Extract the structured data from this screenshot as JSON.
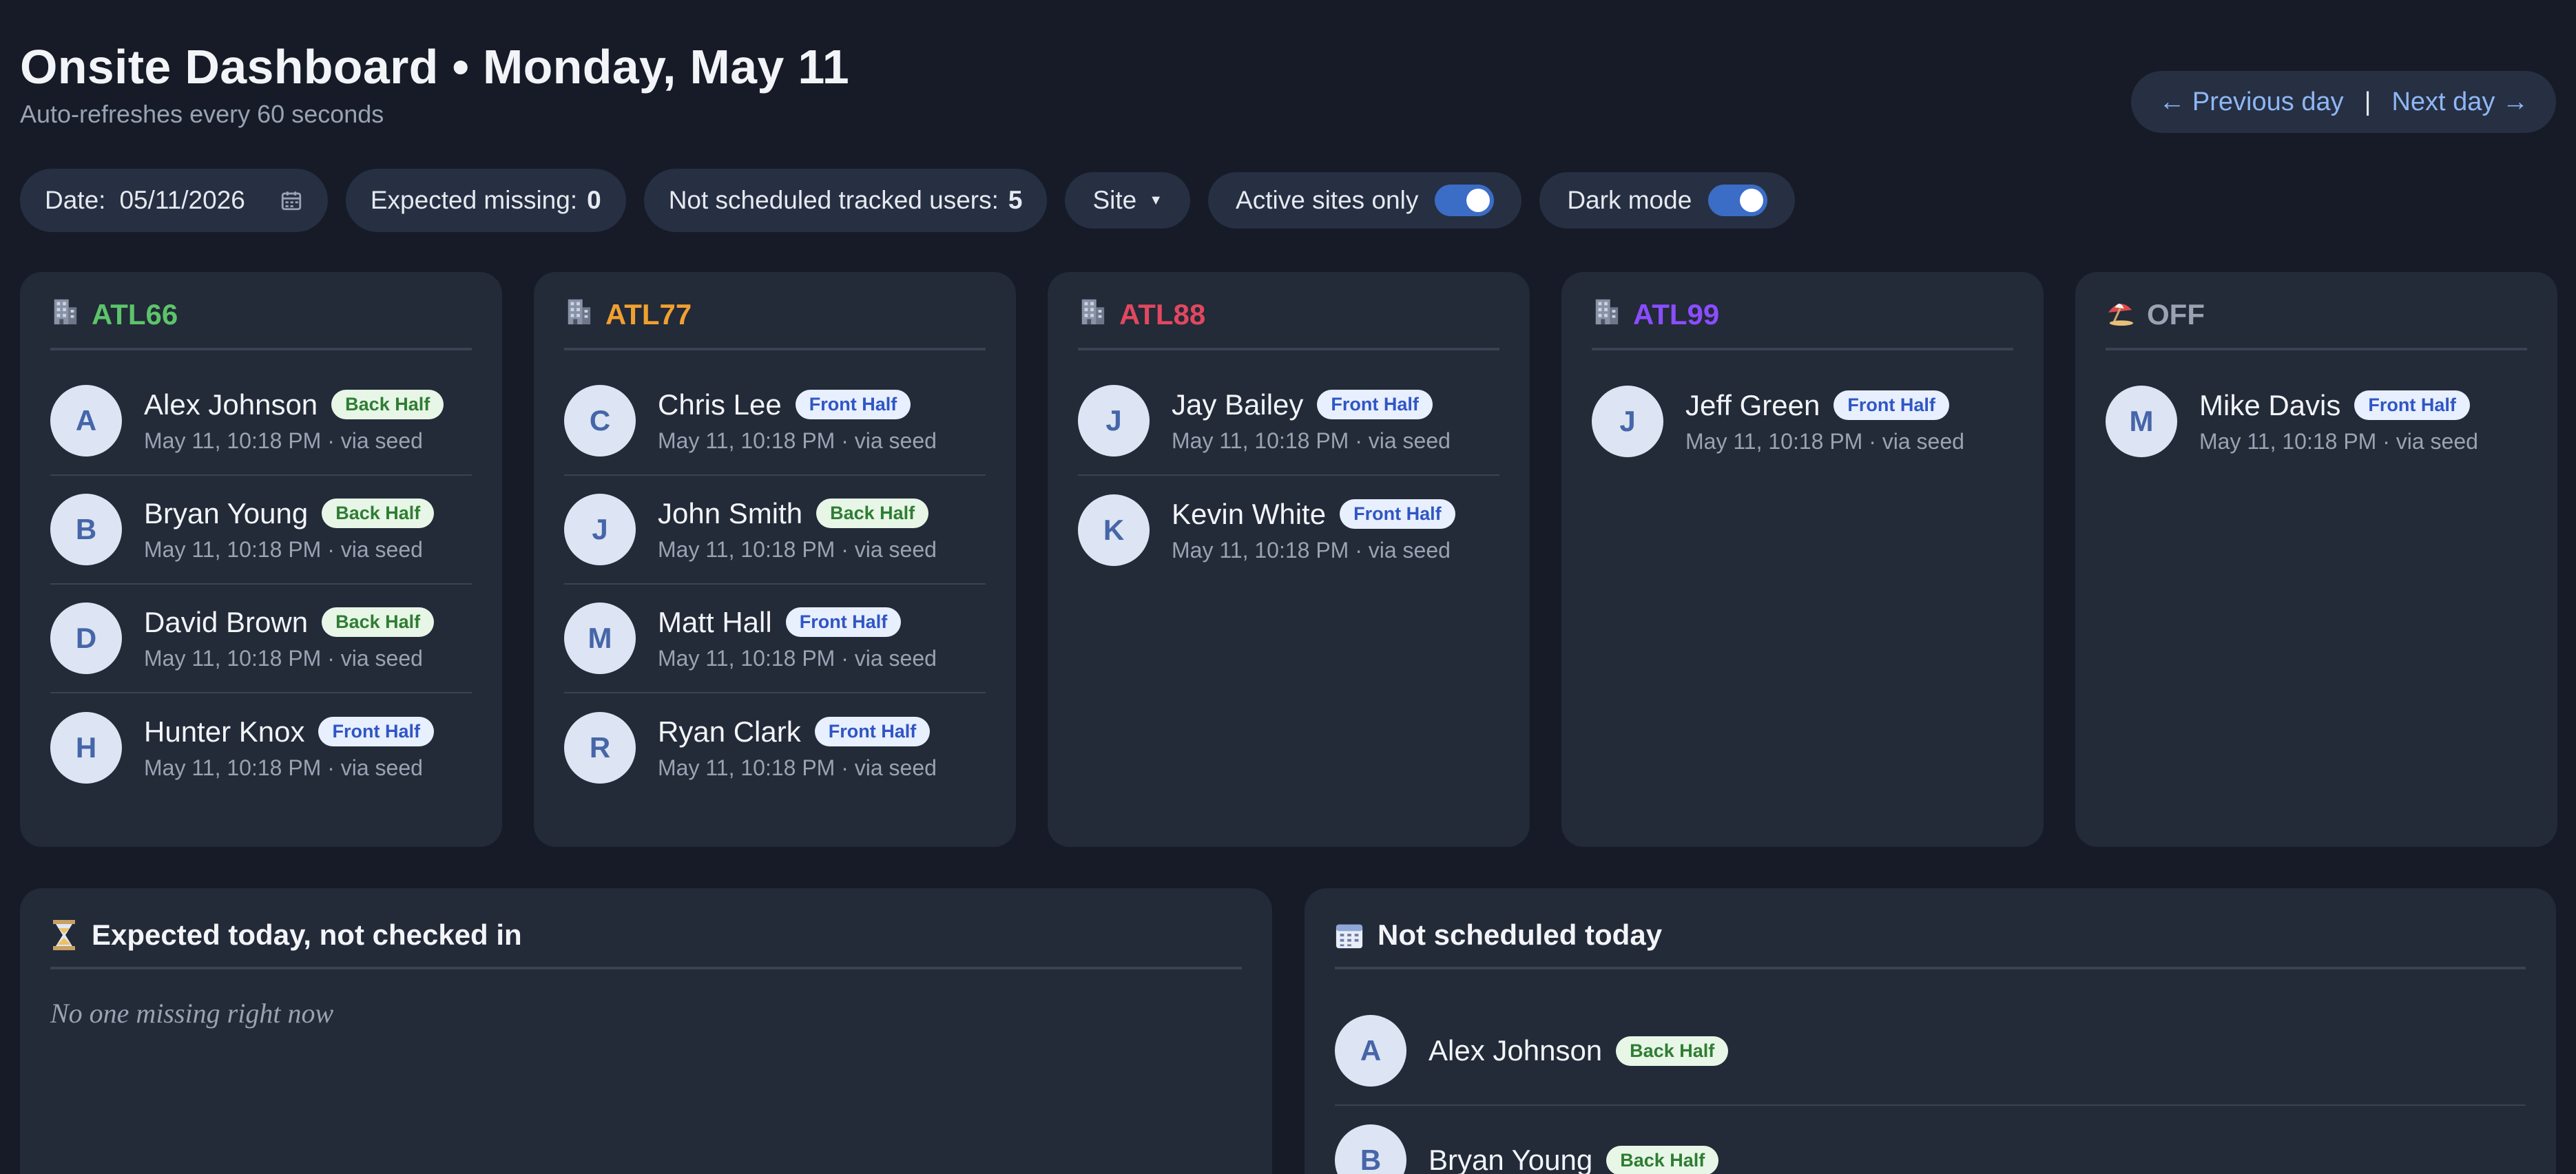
{
  "header": {
    "title": "Onsite Dashboard • Monday, May 11",
    "subtitle": "Auto-refreshes every 60 seconds",
    "prev_label": "← Previous day",
    "sep": "|",
    "next_label": "Next day →"
  },
  "toolbar": {
    "date_label": "Date:",
    "date_value": "05/11/2026",
    "expected_missing_label": "Expected missing:",
    "expected_missing_value": "0",
    "not_scheduled_label": "Not scheduled tracked users:",
    "not_scheduled_value": "5",
    "site_select": "Site",
    "active_sites_label": "Active sites only",
    "dark_mode_label": "Dark mode"
  },
  "colors": {
    "ATL66": "#5cc46a",
    "ATL77": "#f0a030",
    "ATL88": "#e0485e",
    "ATL99": "#8a4dff",
    "OFF": "#9aa3b3"
  },
  "sites": [
    {
      "name": "ATL66",
      "icon": "building-icon",
      "people": [
        {
          "initial": "A",
          "name": "Alex Johnson",
          "badge": "Back Half",
          "meta": "May 11, 10:18 PM · via seed"
        },
        {
          "initial": "B",
          "name": "Bryan Young",
          "badge": "Back Half",
          "meta": "May 11, 10:18 PM · via seed"
        },
        {
          "initial": "D",
          "name": "David Brown",
          "badge": "Back Half",
          "meta": "May 11, 10:18 PM · via seed"
        },
        {
          "initial": "H",
          "name": "Hunter Knox",
          "badge": "Front Half",
          "meta": "May 11, 10:18 PM · via seed"
        }
      ]
    },
    {
      "name": "ATL77",
      "icon": "building-icon",
      "people": [
        {
          "initial": "C",
          "name": "Chris Lee",
          "badge": "Front Half",
          "meta": "May 11, 10:18 PM · via seed"
        },
        {
          "initial": "J",
          "name": "John Smith",
          "badge": "Back Half",
          "meta": "May 11, 10:18 PM · via seed"
        },
        {
          "initial": "M",
          "name": "Matt Hall",
          "badge": "Front Half",
          "meta": "May 11, 10:18 PM · via seed"
        },
        {
          "initial": "R",
          "name": "Ryan Clark",
          "badge": "Front Half",
          "meta": "May 11, 10:18 PM · via seed"
        }
      ]
    },
    {
      "name": "ATL88",
      "icon": "building-icon",
      "people": [
        {
          "initial": "J",
          "name": "Jay Bailey",
          "badge": "Front Half",
          "meta": "May 11, 10:18 PM · via seed"
        },
        {
          "initial": "K",
          "name": "Kevin White",
          "badge": "Front Half",
          "meta": "May 11, 10:18 PM · via seed"
        }
      ]
    },
    {
      "name": "ATL99",
      "icon": "building-icon",
      "people": [
        {
          "initial": "J",
          "name": "Jeff Green",
          "badge": "Front Half",
          "meta": "May 11, 10:18 PM · via seed"
        }
      ]
    },
    {
      "name": "OFF",
      "icon": "beach-umbrella-icon",
      "people": [
        {
          "initial": "M",
          "name": "Mike Davis",
          "badge": "Front Half",
          "meta": "May 11, 10:18 PM · via seed"
        }
      ]
    }
  ],
  "missing_panel": {
    "title": "Expected today, not checked in",
    "icon": "hourglass-icon",
    "empty_text": "No one missing right now"
  },
  "not_scheduled_panel": {
    "title": "Not scheduled today",
    "icon": "calendar-icon",
    "people": [
      {
        "initial": "A",
        "name": "Alex Johnson",
        "badge": "Back Half"
      },
      {
        "initial": "B",
        "name": "Bryan Young",
        "badge": "Back Half"
      }
    ]
  }
}
